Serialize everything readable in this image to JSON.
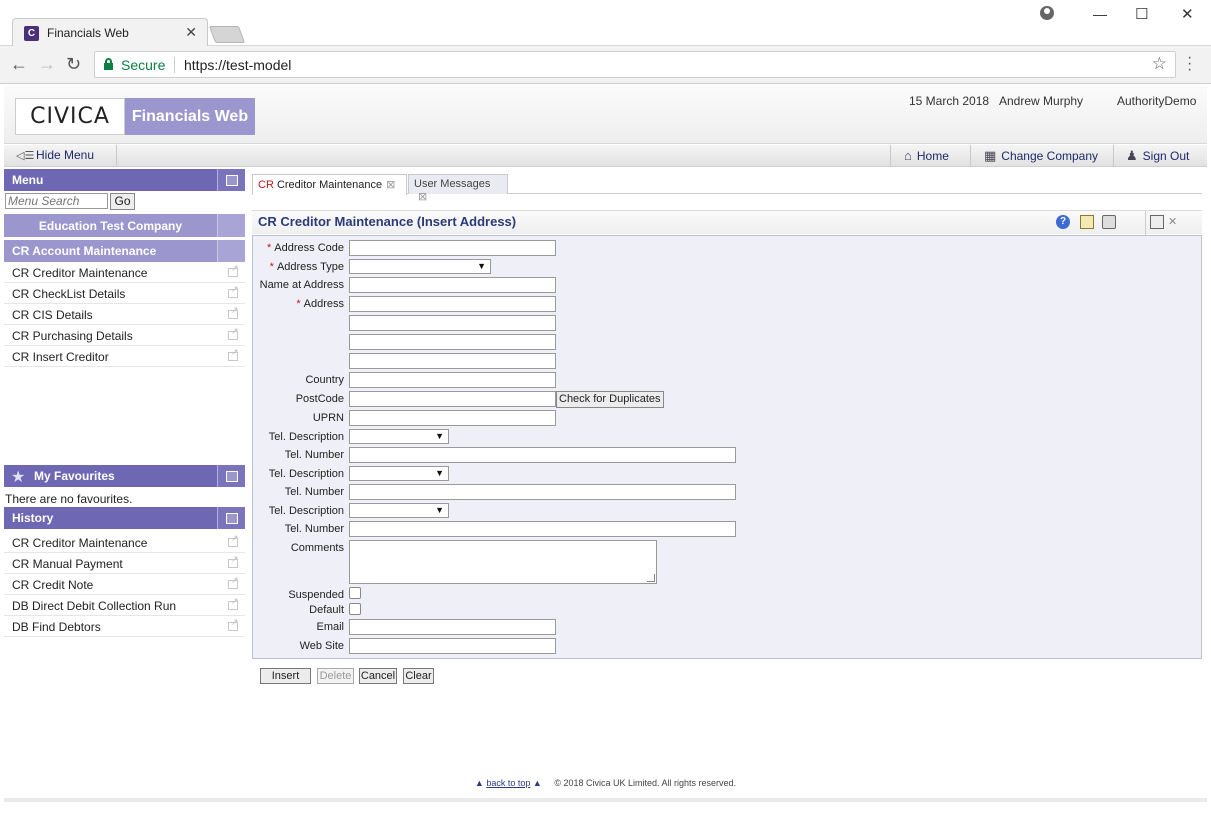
{
  "browser": {
    "tab_title": "Financials Web",
    "tab_favicon": "C",
    "secure_label": "Secure",
    "url": "https://test-model"
  },
  "header": {
    "logo": "CIVICA",
    "product": "Financials Web",
    "date": "15 March 2018",
    "user": "Andrew Murphy",
    "authority": "AuthorityDemo"
  },
  "toolbar": {
    "hide_menu": "Hide Menu",
    "home": "Home",
    "change_company": "Change Company",
    "sign_out": "Sign Out"
  },
  "sidebar": {
    "menu_title": "Menu",
    "search_placeholder": "Menu Search",
    "go": "Go",
    "company": "Education Test Company",
    "section": "CR Account Maintenance",
    "items": [
      {
        "label": "CR Creditor Maintenance"
      },
      {
        "label": "CR CheckList Details"
      },
      {
        "label": "CR CIS Details"
      },
      {
        "label": "CR Purchasing Details"
      },
      {
        "label": "CR Insert Creditor"
      }
    ],
    "favourites_title": "My Favourites",
    "favourites_empty": "There are no favourites.",
    "history_title": "History",
    "history": [
      {
        "label": "CR Creditor Maintenance"
      },
      {
        "label": "CR Manual Payment"
      },
      {
        "label": "CR Credit Note"
      },
      {
        "label": "DB Direct Debit Collection Run"
      },
      {
        "label": "DB Find Debtors"
      }
    ]
  },
  "main": {
    "tabs": [
      {
        "prefix": "CR",
        "label": " Creditor Maintenance"
      },
      {
        "label": "User Messages"
      }
    ],
    "form_title": "CR Creditor Maintenance (Insert Address)",
    "help_glyph": "?",
    "labels": {
      "address_code": "Address Code",
      "address_type": "Address Type",
      "name_at_address": "Name at Address",
      "address": "Address",
      "country": "Country",
      "postcode": "PostCode",
      "uprn": "UPRN",
      "tel_description": "Tel. Description",
      "tel_number": "Tel. Number",
      "comments": "Comments",
      "suspended": "Suspended",
      "default": "Default",
      "email": "Email",
      "web_site": "Web Site"
    },
    "required_mark": "*",
    "check_duplicates": "Check for Duplicates",
    "buttons": {
      "insert": "Insert",
      "delete": "Delete",
      "cancel": "Cancel",
      "clear": "Clear"
    }
  },
  "footer": {
    "back_to_top": "back to top",
    "copyright": "© 2018 Civica UK Limited. All rights reserved."
  },
  "icons": [
    "lock-icon",
    "star-icon",
    "home-icon",
    "company-icon",
    "sign-out-icon",
    "help-icon",
    "export-icon",
    "print-icon",
    "window-icon",
    "close-icon",
    "favourites-star-icon"
  ],
  "colors": {
    "brand_purple": "#6e67b4",
    "light_purple": "#9c96cf",
    "required_red": "#c21a1a",
    "secure_green": "#0b8043"
  }
}
